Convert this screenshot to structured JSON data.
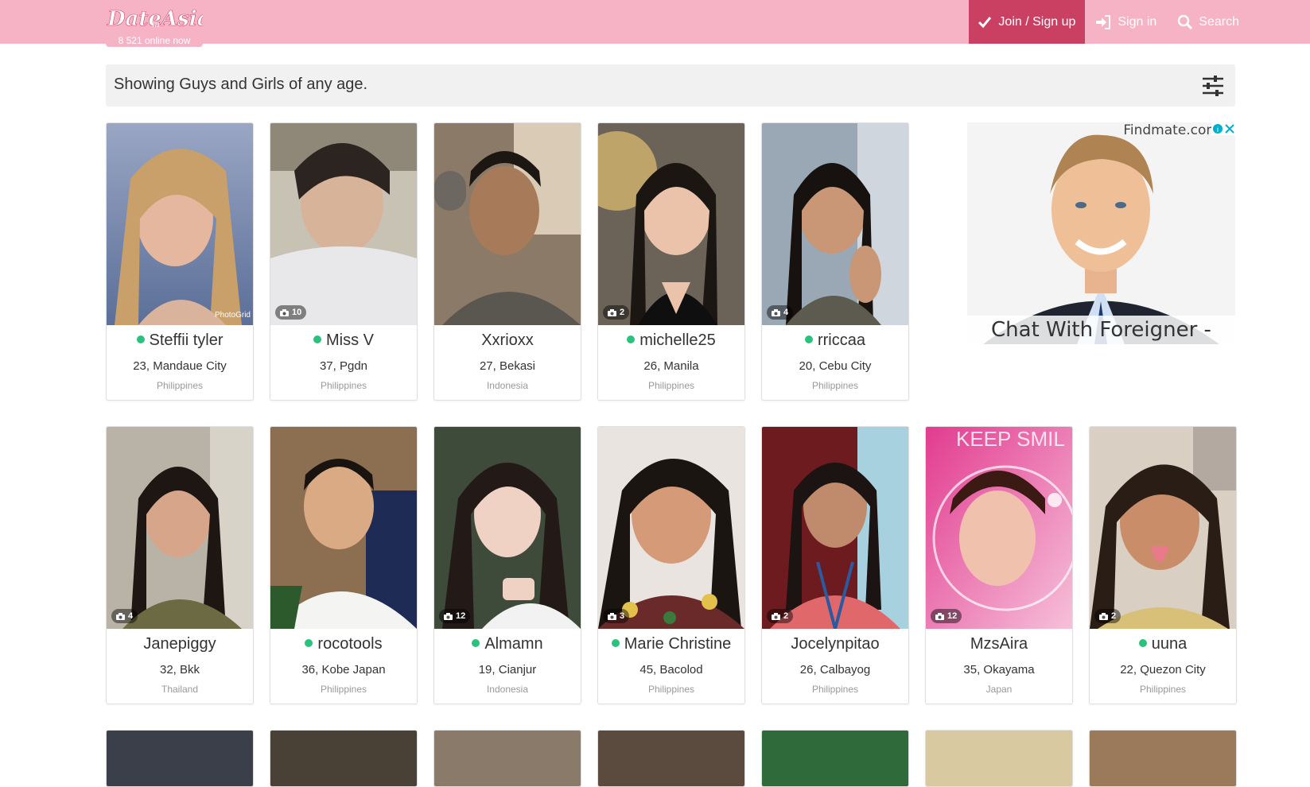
{
  "header": {
    "logo_text": "Date in Asia",
    "online_now": "8 521 online now",
    "nav": {
      "join": "Join / Sign up",
      "signin": "Sign in",
      "search": "Search"
    },
    "colors": {
      "bar": "#f7b3c6",
      "active": "#c94063"
    }
  },
  "filter": {
    "text": "Showing Guys and Girls of any age.",
    "icon": "sliders-icon"
  },
  "profiles_row1": [
    {
      "name": "Steffii tyler",
      "online": true,
      "age_city": "23, Mandaue City",
      "country": "Philippines",
      "photos": "",
      "watermark": "PhotoGrid"
    },
    {
      "name": "Miss V",
      "online": true,
      "age_city": "37, Pgdn",
      "country": "Philippines",
      "photos": "10",
      "watermark": ""
    },
    {
      "name": "Xxrioxx",
      "online": false,
      "age_city": "27, Bekasi",
      "country": "Indonesia",
      "photos": "",
      "watermark": ""
    },
    {
      "name": "michelle25",
      "online": true,
      "age_city": "26, Manila",
      "country": "Philippines",
      "photos": "2",
      "watermark": ""
    },
    {
      "name": "rriccaa",
      "online": true,
      "age_city": "20, Cebu City",
      "country": "Philippines",
      "photos": "4",
      "watermark": ""
    }
  ],
  "profiles_row2": [
    {
      "name": "Janepiggy",
      "online": false,
      "age_city": "32, Bkk",
      "country": "Thailand",
      "photos": "4"
    },
    {
      "name": "rocotools",
      "online": true,
      "age_city": "36, Kobe Japan",
      "country": "Philippines",
      "photos": ""
    },
    {
      "name": "Almamn",
      "online": true,
      "age_city": "19, Cianjur",
      "country": "Indonesia",
      "photos": "12"
    },
    {
      "name": "Marie Christine",
      "online": true,
      "age_city": "45, Bacolod",
      "country": "Philippines",
      "photos": "3"
    },
    {
      "name": "Jocelynpitao",
      "online": false,
      "age_city": "26, Calbayog",
      "country": "Philippines",
      "photos": "2"
    },
    {
      "name": "MzsAira",
      "online": false,
      "age_city": "35, Okayama",
      "country": "Japan",
      "photos": "12",
      "overlay": "KEEP SMIL"
    },
    {
      "name": "uuna",
      "online": true,
      "age_city": "22, Quezon City",
      "country": "Philippines",
      "photos": "2"
    }
  ],
  "ad": {
    "brand": "Findmate.com",
    "caption": "Chat With Foreigner - Free",
    "close_icon": "ad-close-icon"
  }
}
